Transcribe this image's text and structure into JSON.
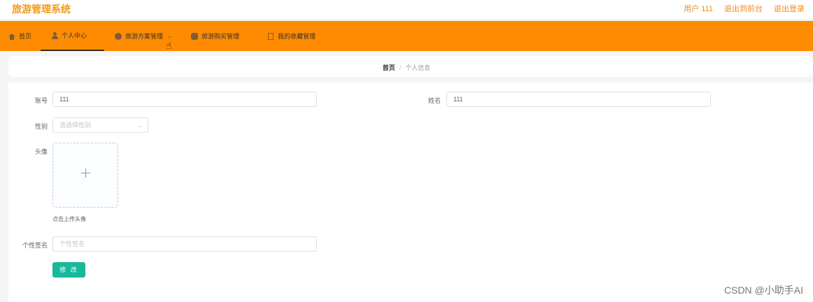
{
  "header": {
    "app_title": "旅游管理系统",
    "user_label": "用户 111",
    "front_link": "退出到前台",
    "logout_link": "退出登录",
    "brand_color": "#f39a1b"
  },
  "nav": {
    "bg_color": "#ff8c00",
    "items": [
      {
        "label": "首页",
        "icon": "home-icon"
      },
      {
        "label": "个人中心",
        "icon": "user-icon",
        "active": true
      },
      {
        "label": "旅游方案管理",
        "icon": "disc-icon",
        "has_dropdown": true
      },
      {
        "label": "旅游购买管理",
        "icon": "cart-icon"
      },
      {
        "label": "我的收藏管理",
        "icon": "file-icon"
      }
    ]
  },
  "breadcrumb": {
    "home": "首页",
    "separator": "/",
    "current": "个人信息"
  },
  "form": {
    "account_label": "账号",
    "account_value": "111",
    "name_label": "姓名",
    "name_value": "111",
    "gender_label": "性别",
    "gender_placeholder": "请选择性别",
    "avatar_label": "头像",
    "avatar_tip": "点击上传头像",
    "signature_label": "个性签名",
    "signature_placeholder": "个性签名",
    "submit_label": "修 改",
    "button_color": "#16b99a"
  },
  "watermark": "CSDN @小助手AI"
}
